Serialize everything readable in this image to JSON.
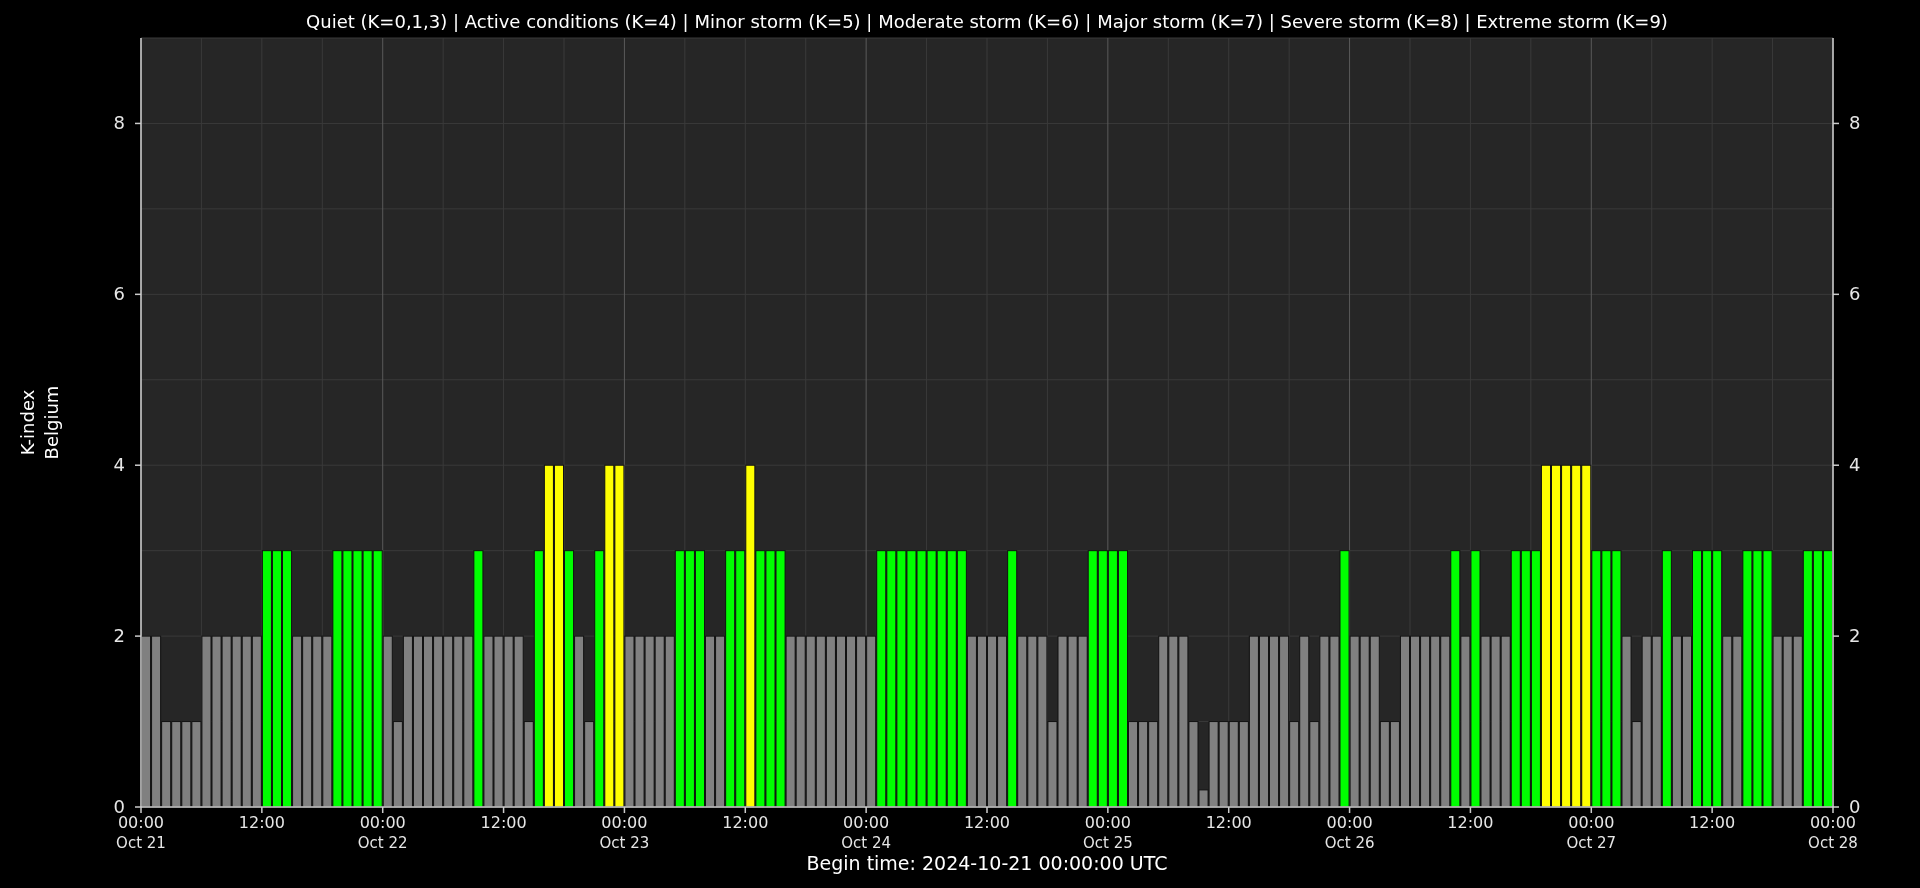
{
  "chart_data": {
    "type": "bar",
    "title": "Quiet (K=0,1,3) | Active conditions (K=4) | Minor storm (K=5) | Moderate storm (K=6) | Major storm (K=7) | Severe storm (K=8) | Extreme storm (K=9)",
    "xlabel": "Begin time: 2024-10-21 00:00:00 UTC",
    "ylabel": "K-index\nBelgium",
    "grid": true,
    "xlim": [
      "2024-10-21T00:00",
      "2024-10-28T00:00"
    ],
    "ylim": [
      0,
      9
    ],
    "yticks": [
      0,
      2,
      4,
      6,
      8
    ],
    "y2lim": [
      0,
      9
    ],
    "y2ticks": [
      0,
      2,
      4,
      6,
      8
    ],
    "x": [
      "2024-10-21T00:00",
      "2024-10-21T01:00",
      "2024-10-21T02:00",
      "2024-10-21T03:00",
      "2024-10-21T04:00",
      "2024-10-21T05:00",
      "2024-10-21T06:00",
      "2024-10-21T07:00",
      "2024-10-21T08:00",
      "2024-10-21T09:00",
      "2024-10-21T10:00",
      "2024-10-21T11:00",
      "2024-10-21T12:00",
      "2024-10-21T13:00",
      "2024-10-21T14:00",
      "2024-10-21T15:00",
      "2024-10-21T16:00",
      "2024-10-21T17:00",
      "2024-10-21T18:00",
      "2024-10-21T19:00",
      "2024-10-21T20:00",
      "2024-10-21T21:00",
      "2024-10-21T22:00",
      "2024-10-21T23:00",
      "2024-10-22T00:00",
      "2024-10-22T01:00",
      "2024-10-22T02:00",
      "2024-10-22T03:00",
      "2024-10-22T04:00",
      "2024-10-22T05:00",
      "2024-10-22T06:00",
      "2024-10-22T07:00",
      "2024-10-22T08:00",
      "2024-10-22T09:00",
      "2024-10-22T10:00",
      "2024-10-22T11:00",
      "2024-10-22T12:00",
      "2024-10-22T13:00",
      "2024-10-22T14:00",
      "2024-10-22T15:00",
      "2024-10-22T16:00",
      "2024-10-22T17:00",
      "2024-10-22T18:00",
      "2024-10-22T19:00",
      "2024-10-22T20:00",
      "2024-10-22T21:00",
      "2024-10-22T22:00",
      "2024-10-22T23:00",
      "2024-10-23T00:00",
      "2024-10-23T01:00",
      "2024-10-23T02:00",
      "2024-10-23T03:00",
      "2024-10-23T04:00",
      "2024-10-23T05:00",
      "2024-10-23T06:00",
      "2024-10-23T07:00",
      "2024-10-23T08:00",
      "2024-10-23T09:00",
      "2024-10-23T10:00",
      "2024-10-23T11:00",
      "2024-10-23T12:00",
      "2024-10-23T13:00",
      "2024-10-23T14:00",
      "2024-10-23T15:00",
      "2024-10-23T16:00",
      "2024-10-23T17:00",
      "2024-10-23T18:00",
      "2024-10-23T19:00",
      "2024-10-23T20:00",
      "2024-10-23T21:00",
      "2024-10-23T22:00",
      "2024-10-23T23:00",
      "2024-10-24T00:00",
      "2024-10-24T01:00",
      "2024-10-24T02:00",
      "2024-10-24T03:00",
      "2024-10-24T04:00",
      "2024-10-24T05:00",
      "2024-10-24T06:00",
      "2024-10-24T07:00",
      "2024-10-24T08:00",
      "2024-10-24T09:00",
      "2024-10-24T10:00",
      "2024-10-24T11:00",
      "2024-10-24T12:00",
      "2024-10-24T13:00",
      "2024-10-24T14:00",
      "2024-10-24T15:00",
      "2024-10-24T16:00",
      "2024-10-24T17:00",
      "2024-10-24T18:00",
      "2024-10-24T19:00",
      "2024-10-24T20:00",
      "2024-10-24T21:00",
      "2024-10-24T22:00",
      "2024-10-24T23:00",
      "2024-10-25T00:00",
      "2024-10-25T01:00",
      "2024-10-25T02:00",
      "2024-10-25T03:00",
      "2024-10-25T04:00",
      "2024-10-25T05:00",
      "2024-10-25T06:00",
      "2024-10-25T07:00",
      "2024-10-25T08:00",
      "2024-10-25T09:00",
      "2024-10-25T10:00",
      "2024-10-25T11:00",
      "2024-10-25T12:00",
      "2024-10-25T13:00",
      "2024-10-25T14:00",
      "2024-10-25T15:00",
      "2024-10-25T16:00",
      "2024-10-25T17:00",
      "2024-10-25T18:00",
      "2024-10-25T19:00",
      "2024-10-25T20:00",
      "2024-10-25T21:00",
      "2024-10-25T22:00",
      "2024-10-25T23:00",
      "2024-10-26T00:00",
      "2024-10-26T01:00",
      "2024-10-26T02:00",
      "2024-10-26T03:00",
      "2024-10-26T04:00",
      "2024-10-26T05:00",
      "2024-10-26T06:00",
      "2024-10-26T07:00",
      "2024-10-26T08:00",
      "2024-10-26T09:00",
      "2024-10-26T10:00",
      "2024-10-26T11:00",
      "2024-10-26T12:00",
      "2024-10-26T13:00",
      "2024-10-26T14:00",
      "2024-10-26T15:00",
      "2024-10-26T16:00",
      "2024-10-26T17:00",
      "2024-10-26T18:00",
      "2024-10-26T19:00",
      "2024-10-26T20:00",
      "2024-10-26T21:00",
      "2024-10-26T22:00",
      "2024-10-26T23:00",
      "2024-10-27T00:00",
      "2024-10-27T01:00",
      "2024-10-27T02:00",
      "2024-10-27T03:00",
      "2024-10-27T04:00",
      "2024-10-27T05:00",
      "2024-10-27T06:00",
      "2024-10-27T07:00",
      "2024-10-27T08:00",
      "2024-10-27T09:00",
      "2024-10-27T10:00",
      "2024-10-27T11:00",
      "2024-10-27T12:00",
      "2024-10-27T13:00",
      "2024-10-27T14:00",
      "2024-10-27T15:00",
      "2024-10-27T16:00",
      "2024-10-27T17:00",
      "2024-10-27T18:00",
      "2024-10-27T19:00",
      "2024-10-27T20:00",
      "2024-10-27T21:00",
      "2024-10-27T22:00",
      "2024-10-27T23:00"
    ],
    "xticks": [
      {
        "value": "2024-10-21T00:00",
        "label": "00:00\nOct 21"
      },
      {
        "value": "2024-10-21T12:00",
        "label": "12:00"
      },
      {
        "value": "2024-10-22T00:00",
        "label": "00:00\nOct 22"
      },
      {
        "value": "2024-10-22T12:00",
        "label": "12:00"
      },
      {
        "value": "2024-10-23T00:00",
        "label": "00:00\nOct 23"
      },
      {
        "value": "2024-10-23T12:00",
        "label": "12:00"
      },
      {
        "value": "2024-10-24T00:00",
        "label": "00:00\nOct 24"
      },
      {
        "value": "2024-10-24T12:00",
        "label": "12:00"
      },
      {
        "value": "2024-10-25T00:00",
        "label": "00:00\nOct 25"
      },
      {
        "value": "2024-10-25T12:00",
        "label": "12:00"
      },
      {
        "value": "2024-10-26T00:00",
        "label": "00:00\nOct 26"
      },
      {
        "value": "2024-10-26T12:00",
        "label": "12:00"
      },
      {
        "value": "2024-10-27T00:00",
        "label": "00:00\nOct 27"
      },
      {
        "value": "2024-10-27T12:00",
        "label": "12:00"
      },
      {
        "value": "2024-10-28T00:00",
        "label": "00:00\nOct 28"
      }
    ],
    "series": [
      {
        "color": "#808080",
        "values": [
          2,
          2,
          1,
          1,
          1,
          1,
          2,
          2,
          2,
          2,
          2,
          2,
          null,
          null,
          null,
          2,
          2,
          2,
          2,
          null,
          null,
          null,
          null,
          null,
          2,
          1,
          2,
          2,
          2,
          2,
          2,
          2,
          2,
          null,
          2,
          2,
          2,
          2,
          1,
          null,
          null,
          null,
          null,
          2,
          1,
          null,
          null,
          null,
          2,
          2,
          2,
          2,
          2,
          null,
          null,
          null,
          2,
          2,
          null,
          null,
          null,
          null,
          null,
          null,
          2,
          2,
          2,
          2,
          2,
          2,
          2,
          2,
          2,
          null,
          null,
          null,
          null,
          null,
          null,
          null,
          null,
          null,
          2,
          2,
          2,
          2,
          null,
          2,
          2,
          2,
          1,
          2,
          2,
          2,
          null,
          null,
          null,
          null,
          1,
          1,
          1,
          2,
          2,
          2,
          1,
          0.2,
          1,
          1,
          1,
          1,
          2,
          2,
          2,
          2,
          1,
          2,
          1,
          2,
          2,
          null,
          2,
          2,
          2,
          1,
          1,
          2,
          2,
          2,
          2,
          2,
          null,
          2,
          null,
          2,
          2,
          2,
          null,
          null,
          null,
          null,
          null,
          null,
          null,
          null,
          null,
          null,
          null,
          2,
          1,
          2,
          2,
          null,
          2,
          2,
          null,
          null,
          null,
          2,
          2,
          null,
          null,
          null,
          2,
          2,
          2,
          null,
          null,
          null
        ]
      },
      {
        "color": "#00ff00",
        "values": [
          null,
          null,
          null,
          null,
          null,
          null,
          null,
          null,
          null,
          null,
          null,
          null,
          3,
          3,
          3,
          null,
          null,
          null,
          null,
          3,
          3,
          3,
          3,
          3,
          null,
          null,
          null,
          null,
          null,
          null,
          null,
          null,
          null,
          3,
          null,
          null,
          null,
          null,
          null,
          3,
          null,
          null,
          3,
          null,
          null,
          3,
          null,
          null,
          null,
          null,
          null,
          null,
          null,
          3,
          3,
          3,
          null,
          null,
          3,
          3,
          null,
          3,
          3,
          3,
          null,
          null,
          null,
          null,
          null,
          null,
          null,
          null,
          null,
          3,
          3,
          3,
          3,
          3,
          3,
          3,
          3,
          3,
          null,
          null,
          null,
          null,
          3,
          null,
          null,
          null,
          null,
          null,
          null,
          null,
          3,
          3,
          3,
          3,
          null,
          null,
          null,
          null,
          null,
          null,
          null,
          null,
          null,
          null,
          null,
          null,
          null,
          null,
          null,
          null,
          null,
          null,
          null,
          null,
          null,
          3,
          null,
          null,
          null,
          null,
          null,
          null,
          null,
          null,
          null,
          null,
          3,
          null,
          3,
          null,
          null,
          null,
          3,
          3,
          3,
          null,
          null,
          null,
          null,
          null,
          3,
          3,
          3,
          null,
          null,
          null,
          null,
          3,
          null,
          null,
          3,
          3,
          3,
          null,
          null,
          3,
          3,
          3,
          null,
          null,
          null,
          3,
          3,
          3
        ]
      },
      {
        "color": "#ffff00",
        "values": [
          null,
          null,
          null,
          null,
          null,
          null,
          null,
          null,
          null,
          null,
          null,
          null,
          null,
          null,
          null,
          null,
          null,
          null,
          null,
          null,
          null,
          null,
          null,
          null,
          null,
          null,
          null,
          null,
          null,
          null,
          null,
          null,
          null,
          null,
          null,
          null,
          null,
          null,
          null,
          null,
          4,
          4,
          null,
          null,
          null,
          null,
          4,
          4,
          null,
          null,
          null,
          null,
          null,
          null,
          null,
          null,
          null,
          null,
          null,
          null,
          4,
          null,
          null,
          null,
          null,
          null,
          null,
          null,
          null,
          null,
          null,
          null,
          null,
          null,
          null,
          null,
          null,
          null,
          null,
          null,
          null,
          null,
          null,
          null,
          null,
          null,
          null,
          null,
          null,
          null,
          null,
          null,
          null,
          null,
          null,
          null,
          null,
          null,
          null,
          null,
          null,
          null,
          null,
          null,
          null,
          null,
          null,
          null,
          null,
          null,
          null,
          null,
          null,
          null,
          null,
          null,
          null,
          null,
          null,
          null,
          null,
          null,
          null,
          null,
          null,
          null,
          null,
          null,
          null,
          null,
          null,
          null,
          null,
          null,
          null,
          null,
          null,
          null,
          null,
          4,
          4,
          4,
          4,
          4,
          null,
          null,
          null,
          null,
          null,
          null,
          null,
          null,
          null,
          null,
          null,
          null,
          null,
          null,
          null,
          null,
          null,
          null,
          null,
          null,
          null,
          null,
          null,
          null
        ]
      }
    ]
  }
}
